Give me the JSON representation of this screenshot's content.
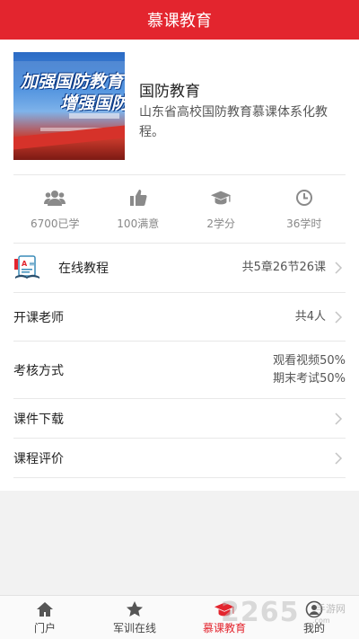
{
  "header": {
    "title": "慕课教育"
  },
  "course": {
    "cover_line1": "加强国防教育",
    "cover_line2": "增强国防",
    "title": "国防教育",
    "description": "山东省高校国防教育慕课体系化教程。"
  },
  "stats": [
    {
      "icon": "users-icon",
      "label": "6700已学"
    },
    {
      "icon": "thumbs-up-icon",
      "label": "100满意"
    },
    {
      "icon": "graduation-cap-icon",
      "label": "2学分"
    },
    {
      "icon": "clock-icon",
      "label": "36学时"
    }
  ],
  "rows": {
    "tutorial": {
      "label": "在线教程",
      "value": "共5章26节26课"
    },
    "teachers": {
      "label": "开课老师",
      "value": "共4人"
    },
    "assessment": {
      "label": "考核方式",
      "value_line1": "观看视频50%",
      "value_line2": "期末考试50%"
    },
    "download": {
      "label": "课件下载"
    },
    "review": {
      "label": "课程评价"
    }
  },
  "tabs": [
    {
      "icon": "home-icon",
      "label": "门户",
      "active": false
    },
    {
      "icon": "star-icon",
      "label": "军训在线",
      "active": false
    },
    {
      "icon": "graduation-cap-icon",
      "label": "慕课教育",
      "active": true
    },
    {
      "icon": "profile-icon",
      "label": "我的",
      "active": false
    }
  ],
  "watermark": {
    "text": "2265",
    "sub": "手游网",
    "domain": ".com"
  },
  "colors": {
    "accent": "#e3252e",
    "icon_gray": "#8a8a8a"
  }
}
